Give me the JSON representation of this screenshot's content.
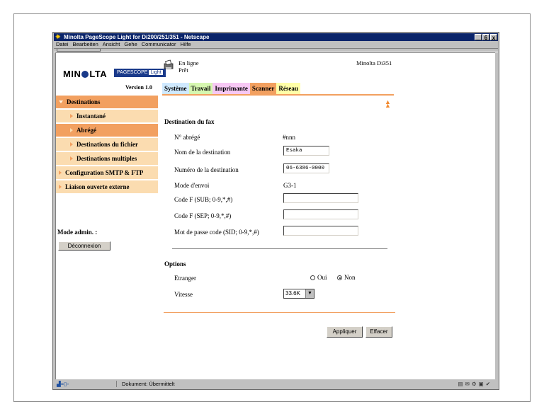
{
  "window": {
    "title": "Minolta PageScope Light for Di200/251/351 - Netscape",
    "controls": [
      "_",
      "6",
      "x"
    ]
  },
  "menu": [
    "Datei",
    "Bearbeiten",
    "Ansicht",
    "Gehe",
    "Communicator",
    "Hilfe"
  ],
  "status_bar": {
    "text": "Dokument: Übermittelt"
  },
  "header": {
    "brand": "MINOLTA",
    "product_badge": "PAGESCOPE",
    "product_badge_suffix": "Light",
    "version": "Version 1.0",
    "status_line1": "En ligne",
    "status_line2": "Prêt",
    "model": "Minolta Di351"
  },
  "tabs": [
    "Système",
    "Travail",
    "Imprimante",
    "Scanner",
    "Réseau"
  ],
  "active_tab": "Scanner",
  "sidebar": {
    "items": [
      {
        "label": "Destinations",
        "level": "top"
      },
      {
        "label": "Instantané",
        "level": "sub"
      },
      {
        "label": "Abrégé",
        "level": "sub",
        "active": true
      },
      {
        "label": "Destinations du fichier",
        "level": "sub"
      },
      {
        "label": "Destinations multiples",
        "level": "sub"
      },
      {
        "label": "Configuration SMTP & FTP",
        "level": "cat"
      },
      {
        "label": "Liaison ouverte externe",
        "level": "cat"
      }
    ],
    "mode_admin": "Mode admin. :",
    "logout_button": "Déconnexion"
  },
  "fax": {
    "section_title": "Destination du fax",
    "abbr_label": "N° abrégé",
    "abbr_value": "#nnn",
    "name_label": "Nom de la destination",
    "name_value": "Esaka",
    "number_label": "Numéro de la destination",
    "number_value": "06-6386-0000",
    "mode_label": "Mode d'envoi",
    "mode_value": "G3-1",
    "sub_label": "Code F (SUB; 0-9,*,#)",
    "sub_value": "",
    "sep_label": "Code F (SEP; 0-9,*,#)",
    "sep_value": "",
    "sid_label": "Mot de passe code (SID; 0-9,*,#)",
    "sid_value": ""
  },
  "options": {
    "section_title": "Options",
    "foreign_label": "Etranger",
    "oui": "Oui",
    "non": "Non",
    "foreign_selected": "Non",
    "speed_label": "Vitesse",
    "speed_value": "33.6K"
  },
  "buttons": {
    "apply": "Appliquer",
    "clear": "Effacer"
  },
  "colors": {
    "accent_orange": "#f2a060",
    "sidebar_light": "#fbdcb0",
    "titlebar": "#0a246a"
  }
}
